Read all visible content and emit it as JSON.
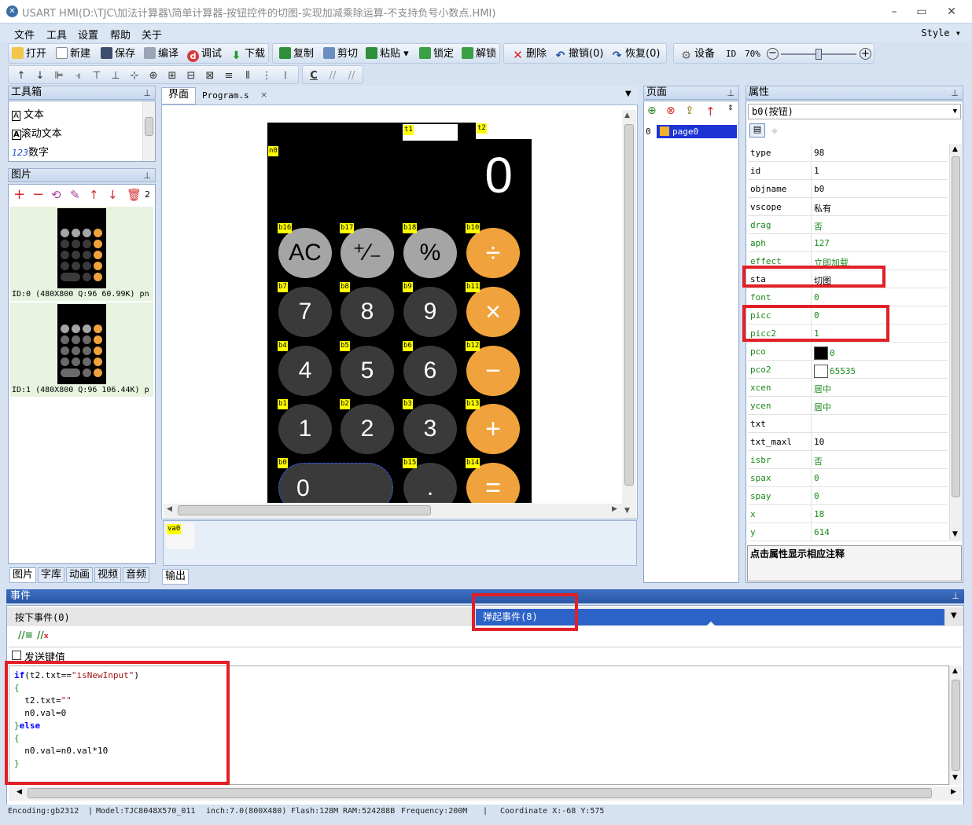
{
  "window": {
    "title": "USART HMI(D:\\TJC\\加法计算器\\简单计算器-按钮控件的切图-实现加减乘除运算-不支持负号小数点.HMI)"
  },
  "menu": [
    "文件",
    "工具",
    "设置",
    "帮助",
    "关于"
  ],
  "style_menu": "Style ▾",
  "toolbar": {
    "open": "打开",
    "new": "新建",
    "save": "保存",
    "compile": "编译",
    "debug": "调试",
    "download": "下载",
    "copy": "复制",
    "cut": "剪切",
    "paste": "粘贴",
    "lock": "锁定",
    "unlock": "解锁",
    "delete": "删除",
    "undo": "撤销(0)",
    "redo": "恢复(0)",
    "device": "设备",
    "id_label": "ID",
    "zoom": "70%",
    "zoom_level": 0.5
  },
  "toolbox": {
    "title": "工具箱",
    "items": [
      {
        "icon": "A",
        "label": "文本"
      },
      {
        "icon": "A",
        "label": "滚动文本"
      },
      {
        "icon": "123",
        "label": "数字"
      }
    ]
  },
  "pictures": {
    "title": "图片",
    "count": "2",
    "items": [
      {
        "caption": "ID:0  (480X800 Q:96 60.99K) pn"
      },
      {
        "caption": "ID:1  (480X800 Q:96 106.44K) p"
      }
    ]
  },
  "left_tabs": [
    "图片",
    "字库",
    "动画",
    "视频",
    "音频"
  ],
  "editor_tabs": [
    "界面",
    "Program.s",
    "×"
  ],
  "calculator": {
    "display": "0",
    "labels": {
      "t1": "t1",
      "t2": "t2",
      "n0": "n0"
    },
    "buttons": [
      {
        "id": "b16",
        "text": "AC",
        "style": "light"
      },
      {
        "id": "b17",
        "text": "⁺∕₋",
        "style": "light"
      },
      {
        "id": "b18",
        "text": "%",
        "style": "light"
      },
      {
        "id": "b10",
        "text": "÷",
        "style": "orange"
      },
      {
        "id": "b7",
        "text": "7",
        "style": "dark"
      },
      {
        "id": "b8",
        "text": "8",
        "style": "dark"
      },
      {
        "id": "b9",
        "text": "9",
        "style": "dark"
      },
      {
        "id": "b11",
        "text": "×",
        "style": "orange"
      },
      {
        "id": "b4",
        "text": "4",
        "style": "dark"
      },
      {
        "id": "b5",
        "text": "5",
        "style": "dark"
      },
      {
        "id": "b6",
        "text": "6",
        "style": "dark"
      },
      {
        "id": "b12",
        "text": "−",
        "style": "orange"
      },
      {
        "id": "b1",
        "text": "1",
        "style": "dark"
      },
      {
        "id": "b2",
        "text": "2",
        "style": "dark"
      },
      {
        "id": "b3",
        "text": "3",
        "style": "dark"
      },
      {
        "id": "b13",
        "text": "+",
        "style": "orange"
      },
      {
        "id": "b0",
        "text": "0",
        "style": "dark"
      },
      {
        "id": "b15",
        "text": ".",
        "style": "dark"
      },
      {
        "id": "b14",
        "text": "=",
        "style": "orange"
      }
    ]
  },
  "variable_area": {
    "va0": "va0"
  },
  "output_tab": "输出",
  "pages_panel": {
    "title": "页面",
    "index": "0",
    "page": "page0"
  },
  "properties": {
    "title": "属性",
    "selected": "b0(按钮)",
    "rows": [
      {
        "key": "type",
        "value": "98",
        "editable": false
      },
      {
        "key": "id",
        "value": "1",
        "editable": false
      },
      {
        "key": "objname",
        "value": "b0",
        "editable": false
      },
      {
        "key": "vscope",
        "value": "私有",
        "editable": false
      },
      {
        "key": "drag",
        "value": "否",
        "editable": true
      },
      {
        "key": "aph",
        "value": "127",
        "editable": true
      },
      {
        "key": "effect",
        "value": "立即加载",
        "editable": true
      },
      {
        "key": "sta",
        "value": "切图",
        "editable": false
      },
      {
        "key": "font",
        "value": "0",
        "editable": true
      },
      {
        "key": "picc",
        "value": "0",
        "editable": true
      },
      {
        "key": "picc2",
        "value": "1",
        "editable": true
      },
      {
        "key": "pco",
        "value": "0",
        "editable": true,
        "swatch": "#000000"
      },
      {
        "key": "pco2",
        "value": "65535",
        "editable": true,
        "swatch": "#ffffff"
      },
      {
        "key": "xcen",
        "value": "居中",
        "editable": true
      },
      {
        "key": "ycen",
        "value": "居中",
        "editable": true
      },
      {
        "key": "txt",
        "value": "",
        "editable": false
      },
      {
        "key": "txt_maxl",
        "value": "10",
        "editable": false
      },
      {
        "key": "isbr",
        "value": "否",
        "editable": true
      },
      {
        "key": "spax",
        "value": "0",
        "editable": true
      },
      {
        "key": "spay",
        "value": "0",
        "editable": true
      },
      {
        "key": "x",
        "value": "18",
        "editable": true
      },
      {
        "key": "y",
        "value": "614",
        "editable": true
      }
    ],
    "hint": "点击属性显示相应注释"
  },
  "events": {
    "title": "事件",
    "press_tab": "按下事件(0)",
    "release_tab": "弹起事件(8)",
    "send_key": "发送键值",
    "code_lines": [
      "if(t2.txt==\"isNewInput\")",
      "{",
      "  t2.txt=\"\"",
      "  n0.val=0",
      "}else",
      "{",
      "  n0.val=n0.val*10",
      "}"
    ]
  },
  "status": {
    "encoding": "Encoding:gb2312",
    "model": "Model:TJC8048X570_011",
    "inch": "inch:7.0(800X480)",
    "flash": "Flash:128M",
    "ram": "RAM:524288B",
    "freq": "Frequency:200M",
    "coord": "Coordinate X:-68  Y:575"
  },
  "colors": {
    "accent": "#1c5fd8",
    "highlight": "#e21f26",
    "label_yellow": "#ffff00",
    "orange": "#f0a33c"
  }
}
